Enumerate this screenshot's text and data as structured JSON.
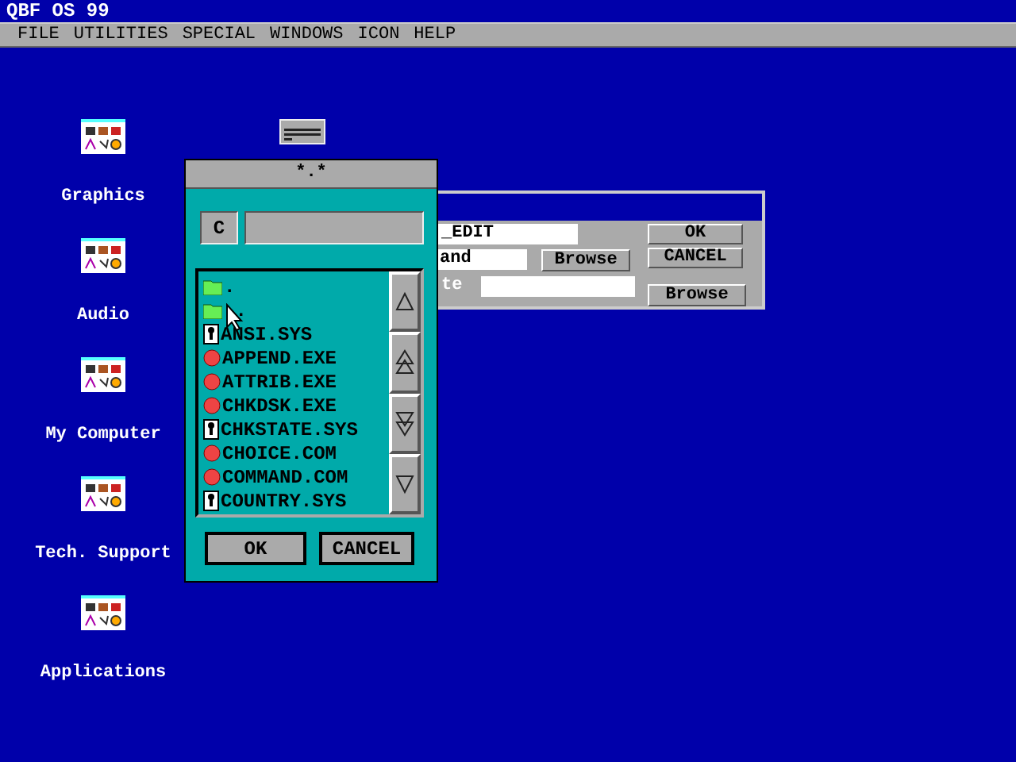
{
  "window": {
    "title": "QBF OS 99"
  },
  "menu": [
    "FILE",
    "UTILITIES",
    "SPECIAL",
    "WINDOWS",
    "ICON",
    "HELP"
  ],
  "desktop_icons": [
    {
      "label": "Graphics"
    },
    {
      "label": "Audio"
    },
    {
      "label": "My Computer"
    },
    {
      "label": "Tech. Support"
    },
    {
      "label": "Applications"
    }
  ],
  "back_dialog": {
    "field_1": "_EDIT",
    "field_2": "and",
    "label_3": "te",
    "buttons": [
      "OK",
      "CANCEL"
    ],
    "browse_1": "Browse",
    "browse_2": "Browse"
  },
  "file_dialog": {
    "title": "*.*",
    "drive": "C",
    "files": [
      {
        "kind": "folder",
        "name": "."
      },
      {
        "kind": "folder",
        "name": ".."
      },
      {
        "kind": "doc",
        "name": "ANSI.SYS"
      },
      {
        "kind": "exe",
        "name": "APPEND.EXE"
      },
      {
        "kind": "exe",
        "name": "ATTRIB.EXE"
      },
      {
        "kind": "exe",
        "name": "CHKDSK.EXE"
      },
      {
        "kind": "doc",
        "name": "CHKSTATE.SYS"
      },
      {
        "kind": "exe",
        "name": "CHOICE.COM"
      },
      {
        "kind": "exe",
        "name": "COMMAND.COM"
      },
      {
        "kind": "doc",
        "name": "COUNTRY.SYS"
      }
    ],
    "buttons": [
      "OK",
      "CANCEL"
    ]
  }
}
